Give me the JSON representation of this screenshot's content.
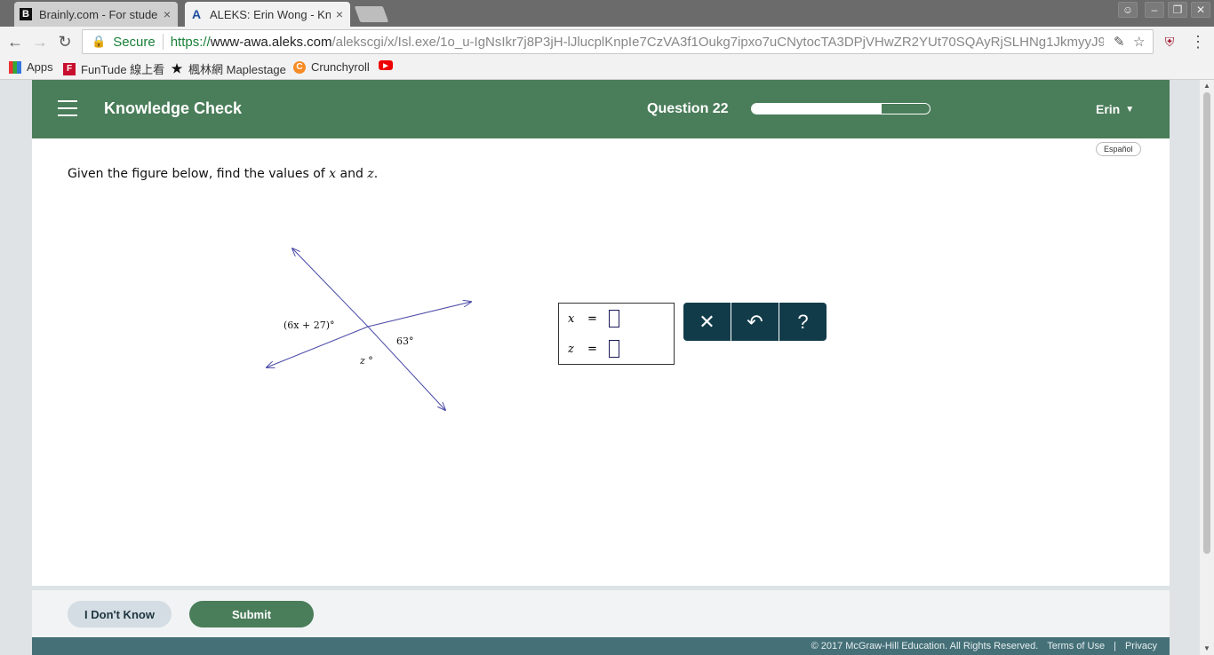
{
  "browser": {
    "tabs": [
      {
        "title": "Brainly.com - For studer",
        "favicon": "brainly-icon",
        "close": "×",
        "active": false
      },
      {
        "title": "ALEKS: Erin Wong - Kno",
        "favicon": "aleks-icon",
        "close": "×",
        "active": true
      }
    ],
    "address": {
      "secure_label": "Secure",
      "url_scheme": "https://",
      "url_host": "www-awa.aleks.com",
      "url_path": "/alekscgi/x/Isl.exe/1o_u-IgNsIkr7j8P3jH-lJlucplKnpIe7CzVA3f1Oukg7ipxo7uCNytocTA3DPjVHwZR2YUt70SQAyRjSLHNg1JkmyyJ98HgCBJr"
    },
    "bookmarks": [
      {
        "label": "Apps",
        "icon": "apps-grid-icon"
      },
      {
        "label": "FunTude 線上看",
        "icon": "funtude-icon"
      },
      {
        "label": "楓林網 Maplestage",
        "icon": "maplestage-icon"
      },
      {
        "label": "Crunchyroll",
        "icon": "crunchyroll-icon"
      },
      {
        "label": "",
        "icon": "youtube-icon"
      }
    ]
  },
  "header": {
    "title": "Knowledge Check",
    "question_label": "Question 22",
    "progress_fraction": 0.73,
    "user_name": "Erin"
  },
  "language_toggle": "Español",
  "prompt": {
    "before": "Given the figure below, find the values of ",
    "var_x": "x",
    "and": " and ",
    "var_z": "z",
    "after": "."
  },
  "figure": {
    "label_left": "(6x + 27)°",
    "label_right": "63°",
    "label_bottom": "z °"
  },
  "answer": {
    "rows": [
      {
        "var": "x",
        "eq": "=",
        "value": ""
      },
      {
        "var": "z",
        "eq": "=",
        "value": ""
      }
    ]
  },
  "actions": {
    "clear": "✕",
    "undo": "↶",
    "help": "?"
  },
  "footer": {
    "idk_label": "I Don't Know",
    "submit_label": "Submit"
  },
  "legal": {
    "copyright": "© 2017 McGraw-Hill Education. All Rights Reserved.",
    "terms": "Terms of Use",
    "divider": "|",
    "privacy": "Privacy"
  },
  "colors": {
    "header_green": "#4a7d5a",
    "action_navy": "#123b4a",
    "line_color": "#4a4aa8"
  }
}
